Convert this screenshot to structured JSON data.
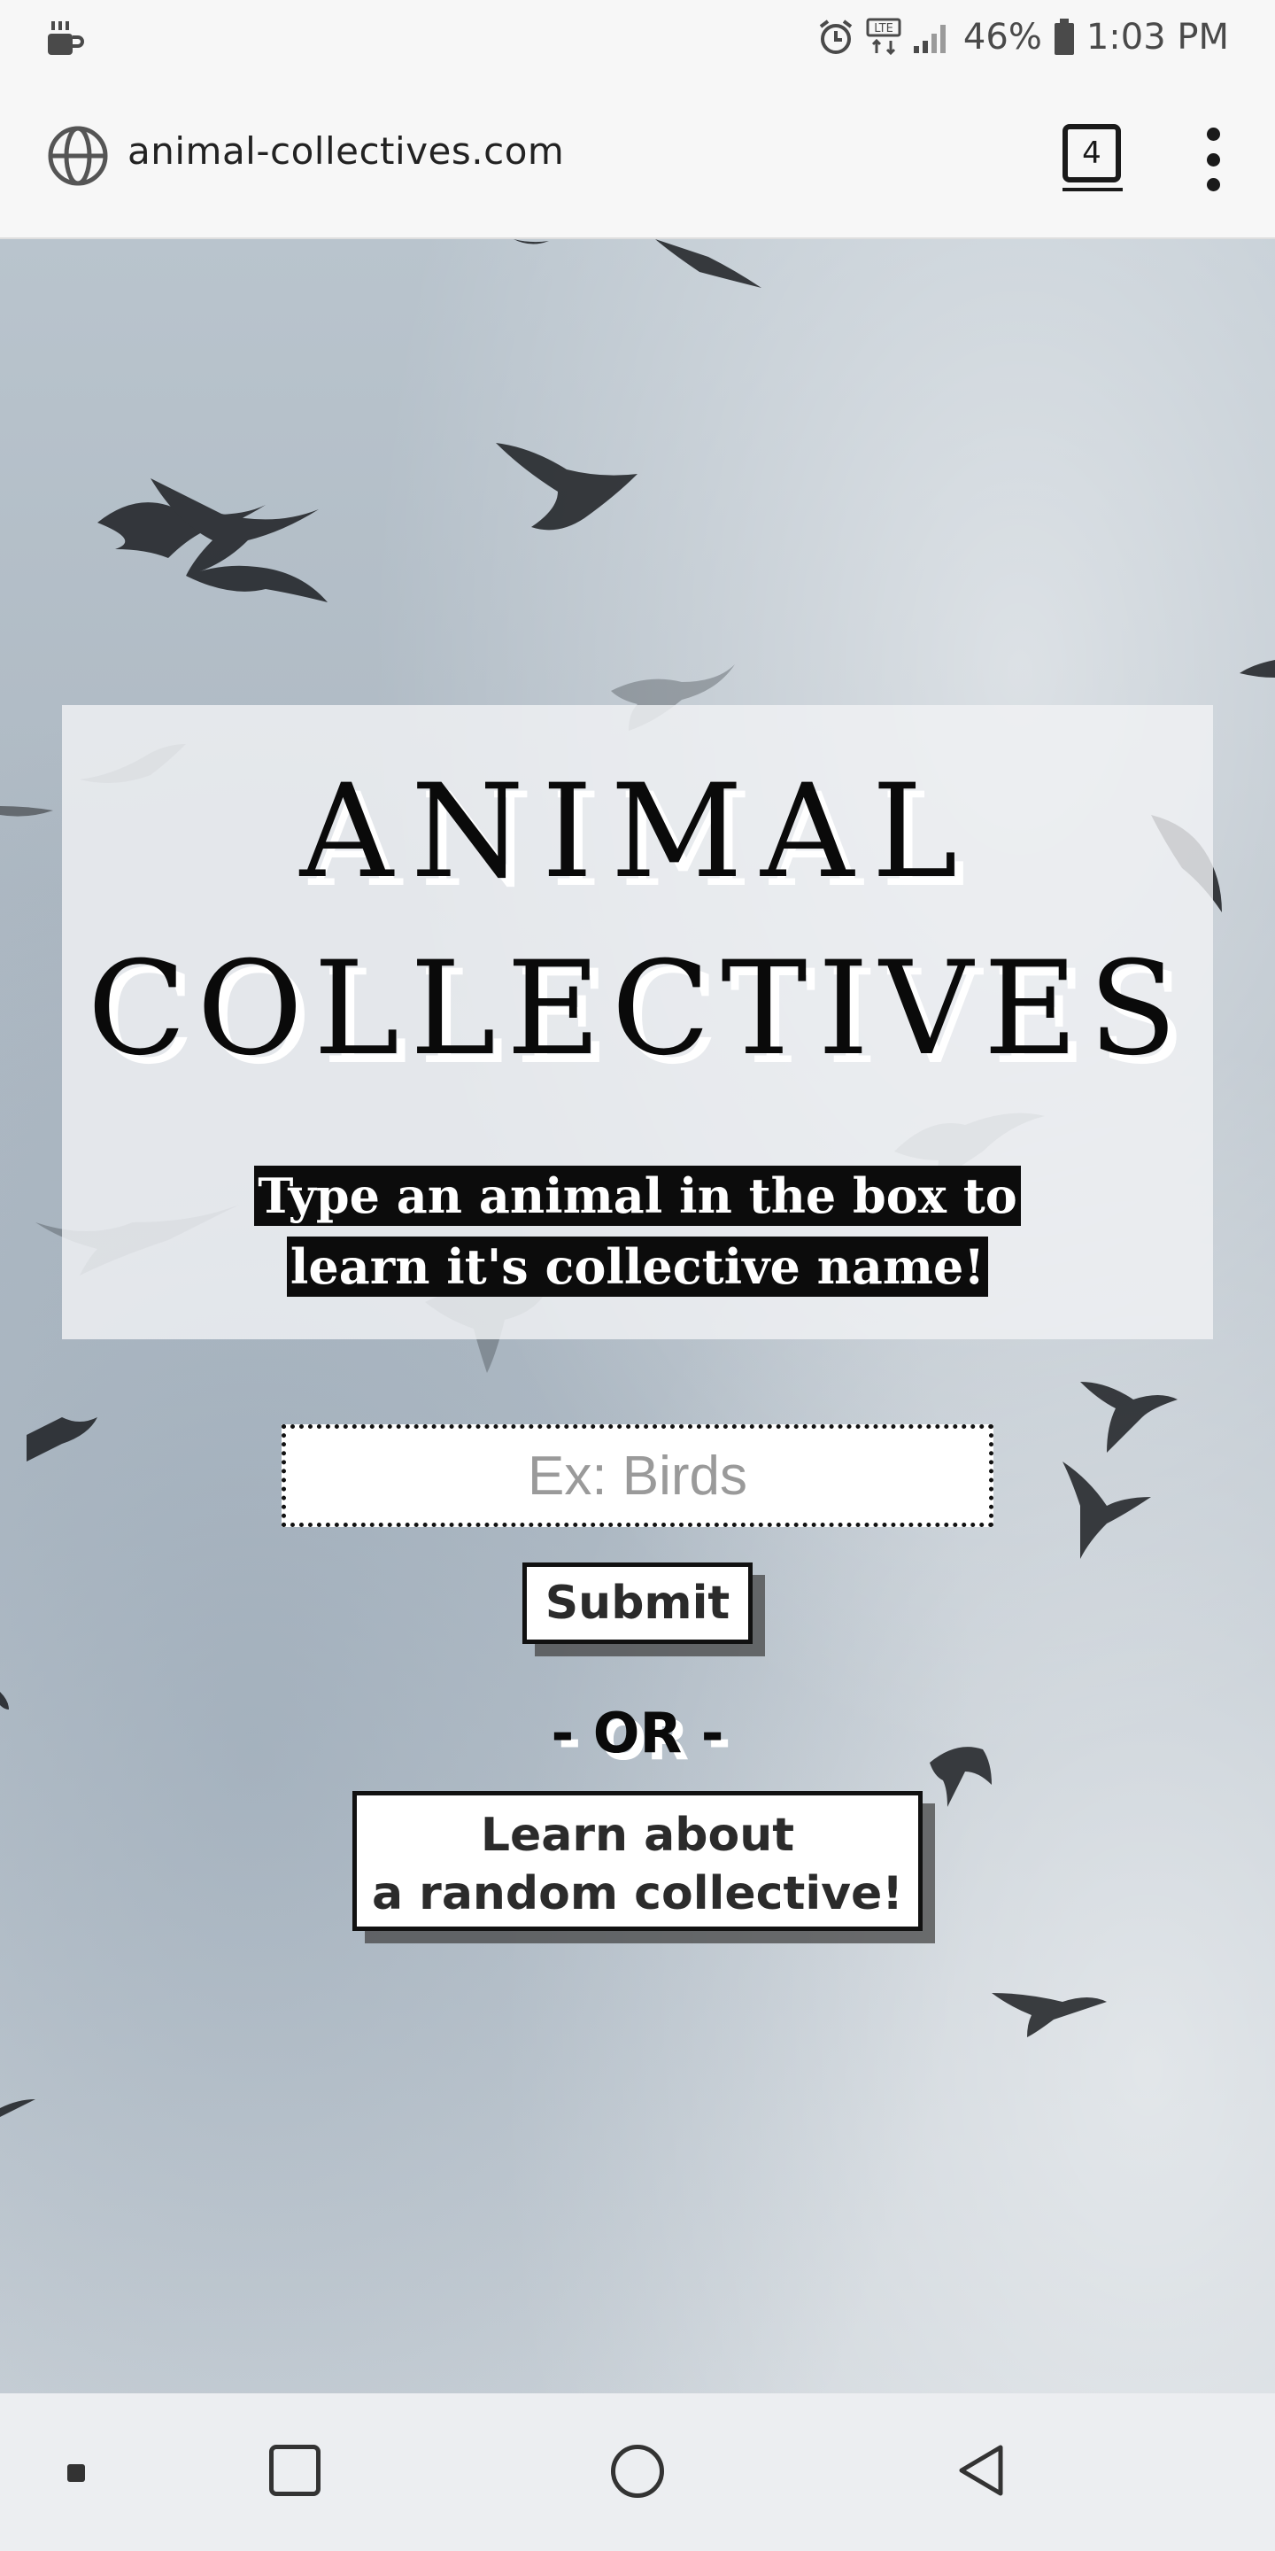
{
  "status_bar": {
    "left_icon": "coffee-cup-icon",
    "icons": [
      "alarm-icon",
      "lte-icon",
      "signal-icon"
    ],
    "battery_percent": "46%",
    "battery_icon": "battery-icon",
    "time": "1:03 PM"
  },
  "browser": {
    "site_icon": "globe-icon",
    "url": "animal-collectives.com",
    "tab_count": "4",
    "menu_icon": "more-vert-icon"
  },
  "page": {
    "title_line1": "ANIMAL",
    "title_line2": "COLLECTIVES",
    "subtitle_line1": "Type an animal in the box to",
    "subtitle_line2": "learn it's collective name!",
    "search": {
      "placeholder": "Ex: Birds",
      "value": ""
    },
    "submit_label": "Submit",
    "or_label": "- OR -",
    "random_label_line1": "Learn about",
    "random_label_line2": "a random collective!"
  },
  "navigation": {
    "buttons": [
      "dot-icon",
      "recents-icon",
      "home-icon",
      "back-icon"
    ]
  },
  "colors": {
    "text_dark": "#0a0a0a",
    "panel_bg": "#f0f2f4",
    "sky": "#b9c4cd",
    "button_shadow": "#464646"
  }
}
